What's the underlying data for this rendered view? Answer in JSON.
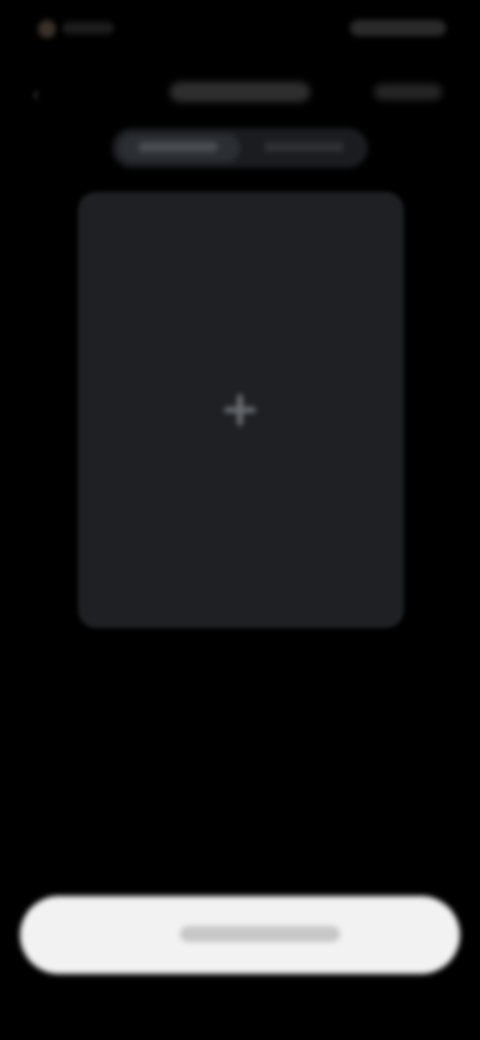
{
  "theme": {
    "background": "#000000",
    "card": "#1e2023",
    "button": "#f2f2f2"
  },
  "icons": {
    "back": "chevron-left-icon",
    "add": "plus-icon"
  },
  "status_bar": {
    "left_text": "",
    "right_text": ""
  },
  "nav": {
    "title": "",
    "action_label": ""
  },
  "segmented_control": {
    "options": [
      "",
      ""
    ],
    "selected_index": 0
  },
  "capture_area": {
    "hint": ""
  },
  "primary_button": {
    "label": ""
  }
}
